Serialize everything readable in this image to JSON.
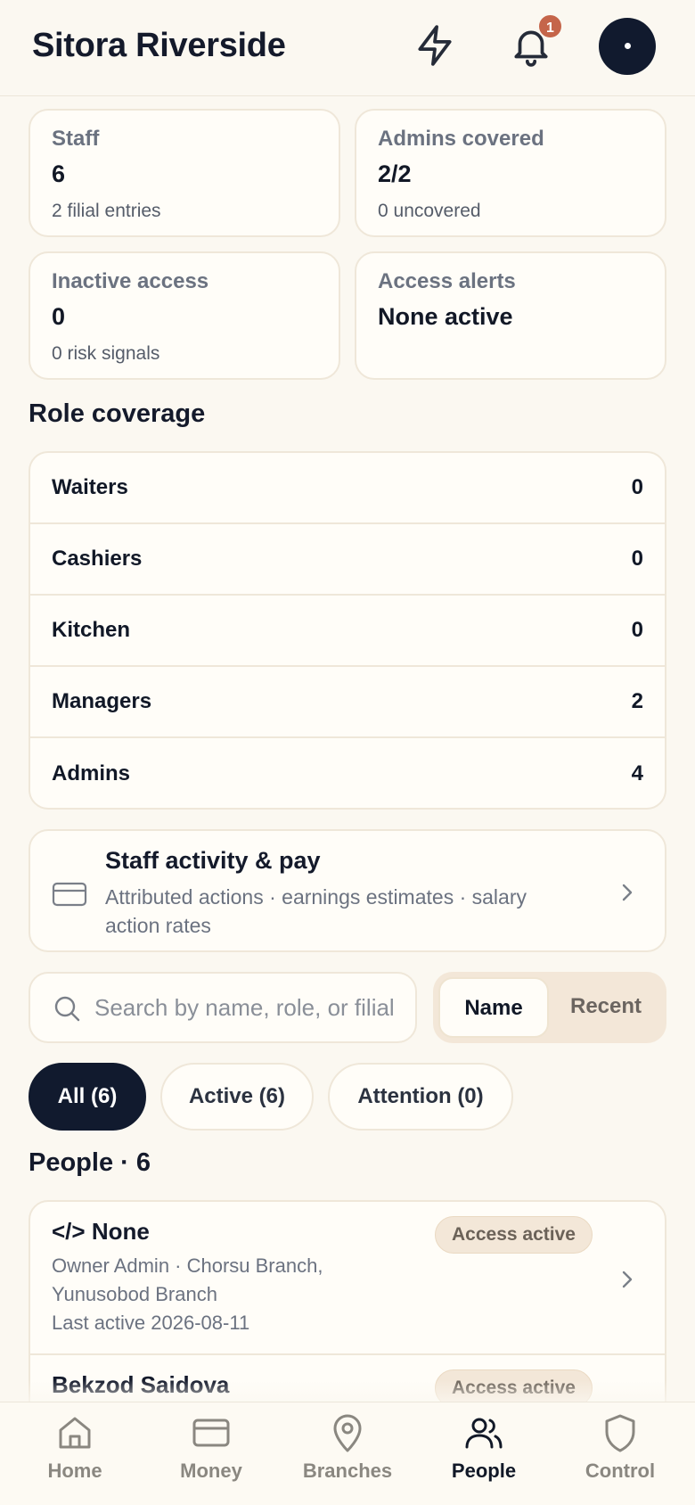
{
  "header": {
    "title": "Sitora Riverside",
    "notification_count": "1"
  },
  "stats": [
    {
      "label": "Staff",
      "value": "6",
      "sub": "2 filial entries"
    },
    {
      "label": "Admins covered",
      "value": "2/2",
      "sub": "0 uncovered"
    },
    {
      "label": "Inactive access",
      "value": "0",
      "sub": "0 risk signals"
    },
    {
      "label": "Access alerts",
      "value": "None active",
      "sub": ""
    }
  ],
  "role_coverage": {
    "title": "Role coverage",
    "rows": [
      {
        "role": "Waiters",
        "count": "0"
      },
      {
        "role": "Cashiers",
        "count": "0"
      },
      {
        "role": "Kitchen",
        "count": "0"
      },
      {
        "role": "Managers",
        "count": "2"
      },
      {
        "role": "Admins",
        "count": "4"
      }
    ]
  },
  "activity": {
    "title": "Staff activity & pay",
    "description": "Attributed actions · earnings estimates · salary action rates"
  },
  "search": {
    "placeholder": "Search by name, role, or filial",
    "value": ""
  },
  "sort": {
    "options": [
      "Name",
      "Recent"
    ],
    "selected": "Name"
  },
  "filters": [
    {
      "label": "All (6)",
      "selected": true
    },
    {
      "label": "Active (6)",
      "selected": false
    },
    {
      "label": "Attention (0)",
      "selected": false
    }
  ],
  "people": {
    "title": "People · 6",
    "items": [
      {
        "name": "</> None",
        "meta": "Owner Admin · Chorsu Branch, Yunusobod Branch",
        "last_active": "Last active 2026-08-11",
        "status": "Access active"
      },
      {
        "name": "Bekzod Saidova",
        "meta": "",
        "last_active": "",
        "status": "Access active"
      }
    ]
  },
  "nav": {
    "items": [
      {
        "label": "Home",
        "icon": "home-icon"
      },
      {
        "label": "Money",
        "icon": "card-icon"
      },
      {
        "label": "Branches",
        "icon": "map-pin-icon"
      },
      {
        "label": "People",
        "icon": "users-icon"
      },
      {
        "label": "Control",
        "icon": "shield-icon"
      }
    ],
    "active": "People"
  },
  "colors": {
    "background": "#fbf8f1",
    "accent_dark": "#111a2e",
    "badge": "#c5654a",
    "status_pill": "#f3e7d8"
  }
}
